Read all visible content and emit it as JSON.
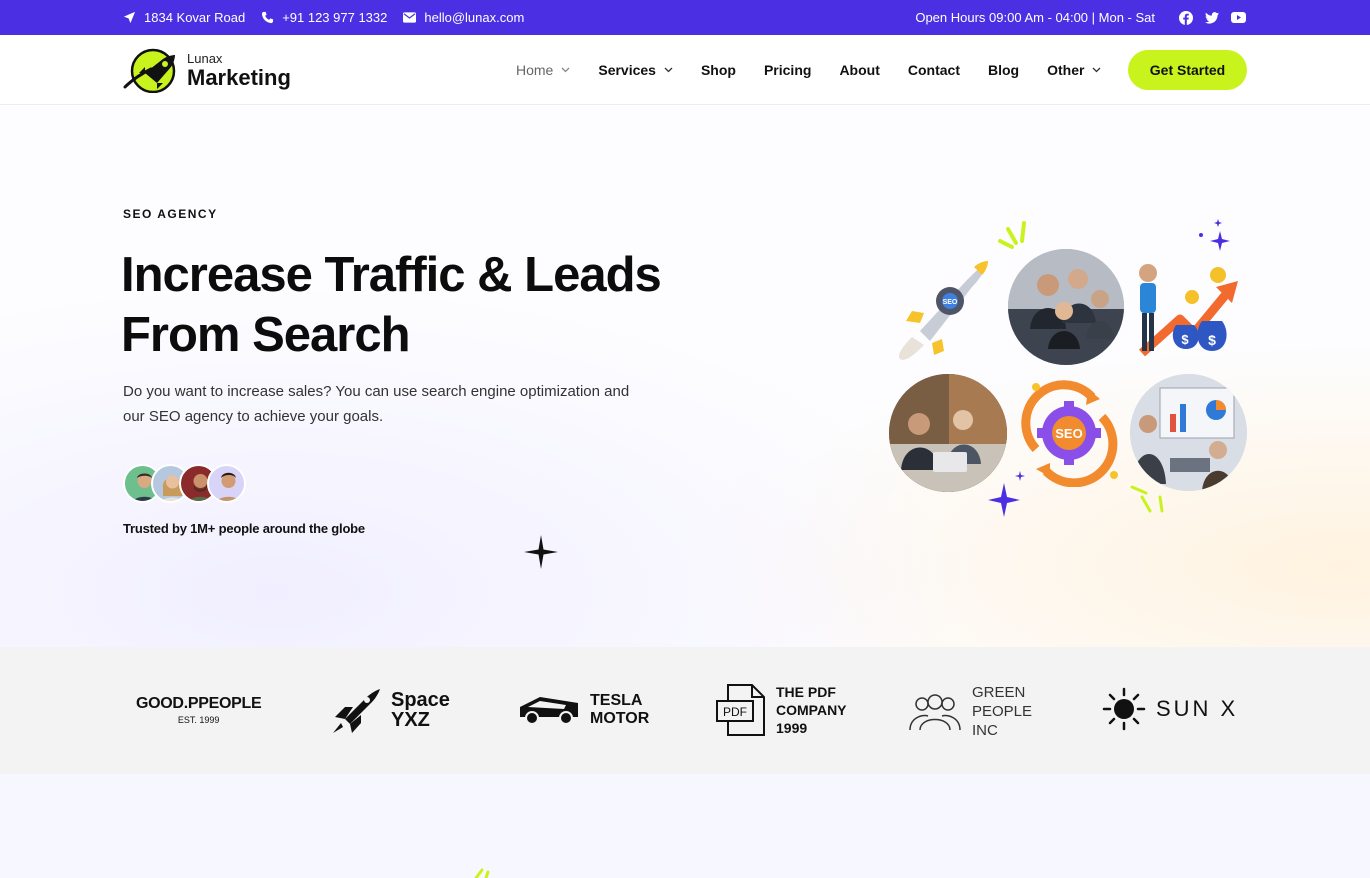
{
  "topbar": {
    "address": "1834 Kovar Road",
    "phone": "+91 123 977 1332",
    "email": "hello@lunax.com",
    "hours": "Open Hours 09:00 Am - 04:00 | Mon - Sat",
    "bg_color": "#4a2fe3"
  },
  "header": {
    "logo_small": "Lunax",
    "logo_big": "Marketing",
    "nav": [
      {
        "label": "Home"
      },
      {
        "label": "Services"
      },
      {
        "label": "Shop"
      },
      {
        "label": "Pricing"
      },
      {
        "label": "About"
      },
      {
        "label": "Contact"
      },
      {
        "label": "Blog"
      },
      {
        "label": "Other"
      }
    ],
    "cta_label": "Get Started",
    "accent_color": "#c9f31d"
  },
  "hero": {
    "eyebrow": "SEO AGENCY",
    "headline_line1": "Increase Traffic & Leads",
    "headline_line2": "From Search",
    "lead_line1": "Do you want to increase sales? You can use search engine optimization and",
    "lead_line2": "our SEO agency to achieve your goals.",
    "trusted": "Trusted by 1M+ people around the globe",
    "seo_badge": "SEO",
    "seo_badge_small": "SEO"
  },
  "brands": {
    "good_people": "GOOD.PPEOPLE",
    "good_people_sub": "EST. 1999",
    "space_line1": "Space",
    "space_line2": "YXZ",
    "tesla_line1": "TESLA",
    "tesla_line2": "MOTOR",
    "pdf_icon": "PDF",
    "pdf_line1": "THE PDF",
    "pdf_line2": "COMPANY",
    "pdf_line3": "1999",
    "green_line1": "GREEN",
    "green_line2": "PEOPLE",
    "green_line3": "INC",
    "sunx": "SUN X"
  }
}
